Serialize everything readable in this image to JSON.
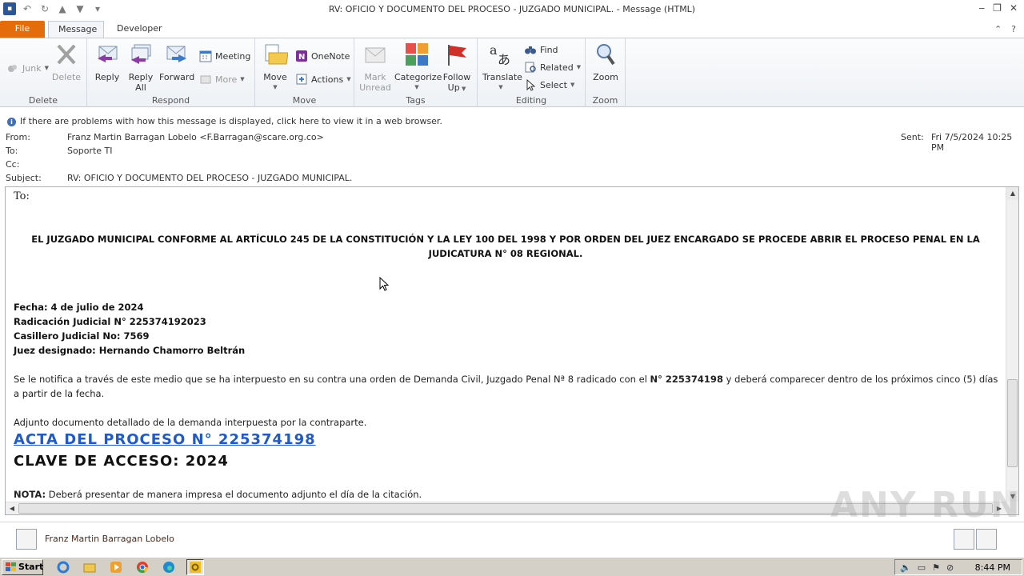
{
  "window": {
    "title": "RV: OFICIO Y DOCUMENTO DEL PROCESO - JUZGADO MUNICIPAL.  -  Message (HTML)"
  },
  "tabs": {
    "file": "File",
    "message": "Message",
    "developer": "Developer"
  },
  "ribbon": {
    "delete_group": {
      "label": "Delete",
      "junk": "Junk",
      "delete": "Delete"
    },
    "respond_group": {
      "label": "Respond",
      "reply": "Reply",
      "reply_all_1": "Reply",
      "reply_all_2": "All",
      "forward": "Forward",
      "meeting": "Meeting",
      "more": "More"
    },
    "move_group": {
      "label": "Move",
      "move": "Move",
      "onenote": "OneNote",
      "actions": "Actions"
    },
    "tags_group": {
      "label": "Tags",
      "mark_unread_1": "Mark",
      "mark_unread_2": "Unread",
      "categorize": "Categorize",
      "follow_up_1": "Follow",
      "follow_up_2": "Up"
    },
    "editing_group": {
      "label": "Editing",
      "translate": "Translate",
      "find": "Find",
      "related": "Related",
      "select": "Select"
    },
    "zoom_group": {
      "label": "Zoom",
      "zoom": "Zoom"
    }
  },
  "infobar": {
    "text": "If there are problems with how this message is displayed, click here to view it in a web browser."
  },
  "headers": {
    "from_label": "From:",
    "from_value": "Franz Martin Barragan Lobelo <F.Barragan@scare.org.co>",
    "to_label": "To:",
    "to_value": "Soporte TI",
    "cc_label": "Cc:",
    "cc_value": "",
    "subject_label": "Subject:",
    "subject_value": "RV: OFICIO Y DOCUMENTO DEL PROCESO - JUZGADO MUNICIPAL.",
    "sent_label": "Sent:",
    "sent_value": "Fri 7/5/2024 10:25 PM"
  },
  "body": {
    "to_line": "To:",
    "heading": "EL JUZGADO MUNICIPAL CONFORME AL ARTÍCULO 245 DE LA CONSTITUCIÓN Y LA LEY 100 DEL 1998 Y POR ORDEN DEL JUEZ ENCARGADO SE PROCEDE ABRIR EL PROCESO PENAL EN LA JUDICATURA N° 08 REGIONAL.",
    "fecha": "Fecha: 4 de julio de 2024",
    "radicacion": "Radicación Judicial N° 225374192023",
    "casillero": "Casillero Judicial No: 7569",
    "juez": "Juez designado: Hernando Chamorro Beltrán",
    "notice_part1": "Se le notifica a través de este medio que se ha interpuesto en su contra una orden de Demanda Civil, Juzgado Penal Nª 8 radicado con el ",
    "notice_bold": "N° 225374198",
    "notice_part2": " y deberá comparecer dentro de los próximos cinco (5) días a partir de la fecha.",
    "adjunto": "Adjunto documento detallado de la demanda interpuesta por la contraparte.",
    "acta_link": "ACTA DEL PROCESO N° 225374198",
    "clave": "CLAVE DE ACCESO: 2024",
    "nota_label": "NOTA:",
    "nota_text": "  Deberá presentar de manera impresa el documento adjunto el día de la citación."
  },
  "people_pane": {
    "name": "Franz Martin Barragan Lobelo"
  },
  "taskbar": {
    "start": "Start",
    "time": "8:44 PM"
  },
  "watermark": "ANY RUN"
}
